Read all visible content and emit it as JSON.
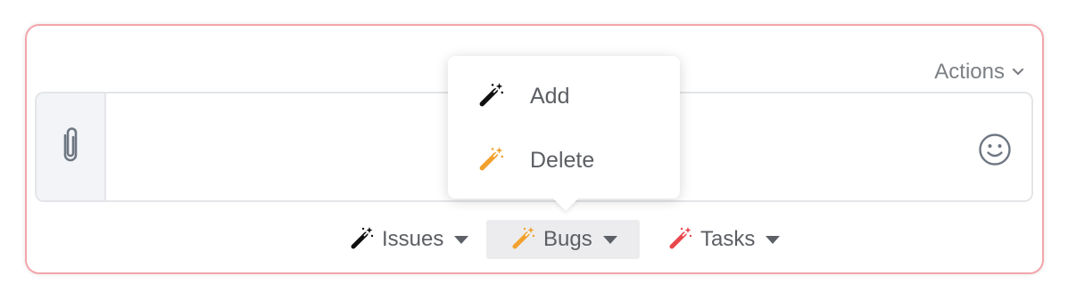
{
  "header": {
    "actions_label": "Actions"
  },
  "editor": {
    "attach_icon": "paperclip-icon",
    "message_value": "",
    "emoji_icon": "smiley-icon"
  },
  "dropdown_menu": {
    "items": [
      {
        "label": "Add",
        "icon": "magic-wand-icon",
        "icon_color": "#111111"
      },
      {
        "label": "Delete",
        "icon": "magic-wand-icon",
        "icon_color": "#f2a12e"
      }
    ]
  },
  "toolbar": {
    "buttons": [
      {
        "label": "Issues",
        "icon_color": "#111111",
        "active": false
      },
      {
        "label": "Bugs",
        "icon_color": "#f2a12e",
        "active": true
      },
      {
        "label": "Tasks",
        "icon_color": "#e8474b",
        "active": false
      }
    ]
  },
  "colors": {
    "card_border": "#f3a5ab",
    "active_button_bg": "#ececee",
    "text": "#5b5e63"
  }
}
